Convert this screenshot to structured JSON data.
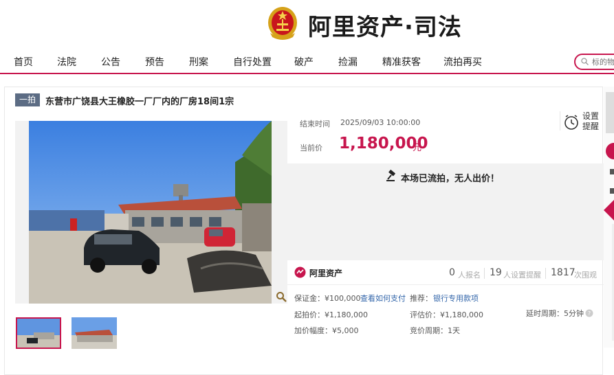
{
  "header": {
    "brand": "阿里资产·司法",
    "accent": "#c7154d"
  },
  "nav": {
    "items": [
      "首页",
      "法院",
      "公告",
      "预告",
      "刑案",
      "自行处置",
      "破产",
      "捡漏",
      "精准获客",
      "流拍再买"
    ],
    "search_placeholder": "标的物"
  },
  "auction": {
    "round_tag": "一拍",
    "title": "东营市广饶县大王橡胶一厂厂内的厂房18间1宗",
    "end_label": "结束时间",
    "end_time": "2025/09/03 10:00:00",
    "remind_label": "设置提醒",
    "price_label": "当前价",
    "price": "1,180,000",
    "price_unit": "元",
    "status": "本场已流拍，无人出价！"
  },
  "platform": {
    "name": "阿里资产",
    "stats": [
      {
        "value": "0",
        "label": "人报名"
      },
      {
        "value": "19",
        "label": "人设置提醒"
      },
      {
        "value": "1817",
        "label": "次围观"
      }
    ]
  },
  "details": {
    "deposit": "保证金：¥100,000",
    "deposit_link": "查看如何支付",
    "recommend_label": "推荐：",
    "recommend_link": "银行专用款项",
    "start_price": "起拍价：¥1,180,000",
    "eval_price": "评估价：¥1,180,000",
    "delay": "延时周期：5分钟",
    "increment": "加价幅度：¥5,000",
    "cycle": "竞价周期：1天"
  },
  "icons": {
    "emblem": "court-emblem-icon",
    "search": "search-icon",
    "alarm": "alarm-clock-icon",
    "hammer": "gavel-icon",
    "zoom": "zoom-icon",
    "logo": "ali-asset-logo-icon",
    "help": "help-icon"
  }
}
